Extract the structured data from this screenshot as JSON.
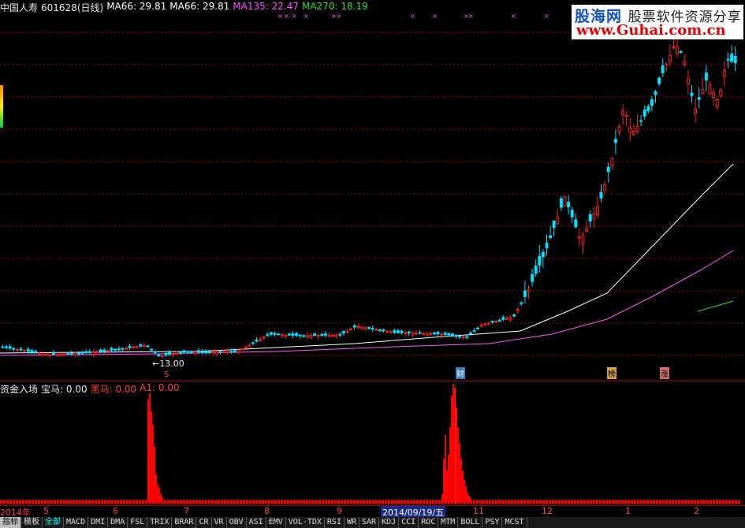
{
  "header": {
    "name": "中国人寿",
    "code_period": "601628(日线)",
    "ma1": "MA66: 29.81",
    "ma2": "MA66: 29.81",
    "ma3": "MA135: 22.47",
    "ma4": "MA270: 18.19"
  },
  "watermark": {
    "brand": "股海网",
    "slogan": "股票软件资源分享",
    "url": "www.Guhai.com.cn"
  },
  "annotations": {
    "low_price": "13.00",
    "s_marker": "S",
    "tag_cai": "财",
    "tag_bang": "榜",
    "tag_zhang": "涨"
  },
  "indicator": {
    "name": "资金入场",
    "items": [
      "宝马: 0.00",
      "黑马: 0.00",
      "A1: 0.00"
    ]
  },
  "axis": {
    "year": "2014年",
    "months": [
      "5",
      "6",
      "7",
      "8",
      "9",
      "11",
      "12",
      "1",
      "2"
    ],
    "cursor_date": "2014/09/19/五"
  },
  "tabs": [
    "指标",
    "模板",
    "全部",
    "MACD",
    "DMI",
    "DMA",
    "FSL",
    "TRIX",
    "BRAR",
    "CR",
    "VR",
    "OBV",
    "ASI",
    "EMV",
    "VOL-TDX",
    "RSI",
    "WR",
    "SAR",
    "KDJ",
    "CCI",
    "ROC",
    "MTM",
    "BOLL",
    "PSY",
    "MCST"
  ],
  "colors": {
    "up": "#ff2020",
    "down": "#00e0ff",
    "ma66": "#ffffff",
    "ma135": "#ff55ff",
    "ma270": "#33dd33",
    "grid": "#aa0000"
  }
}
